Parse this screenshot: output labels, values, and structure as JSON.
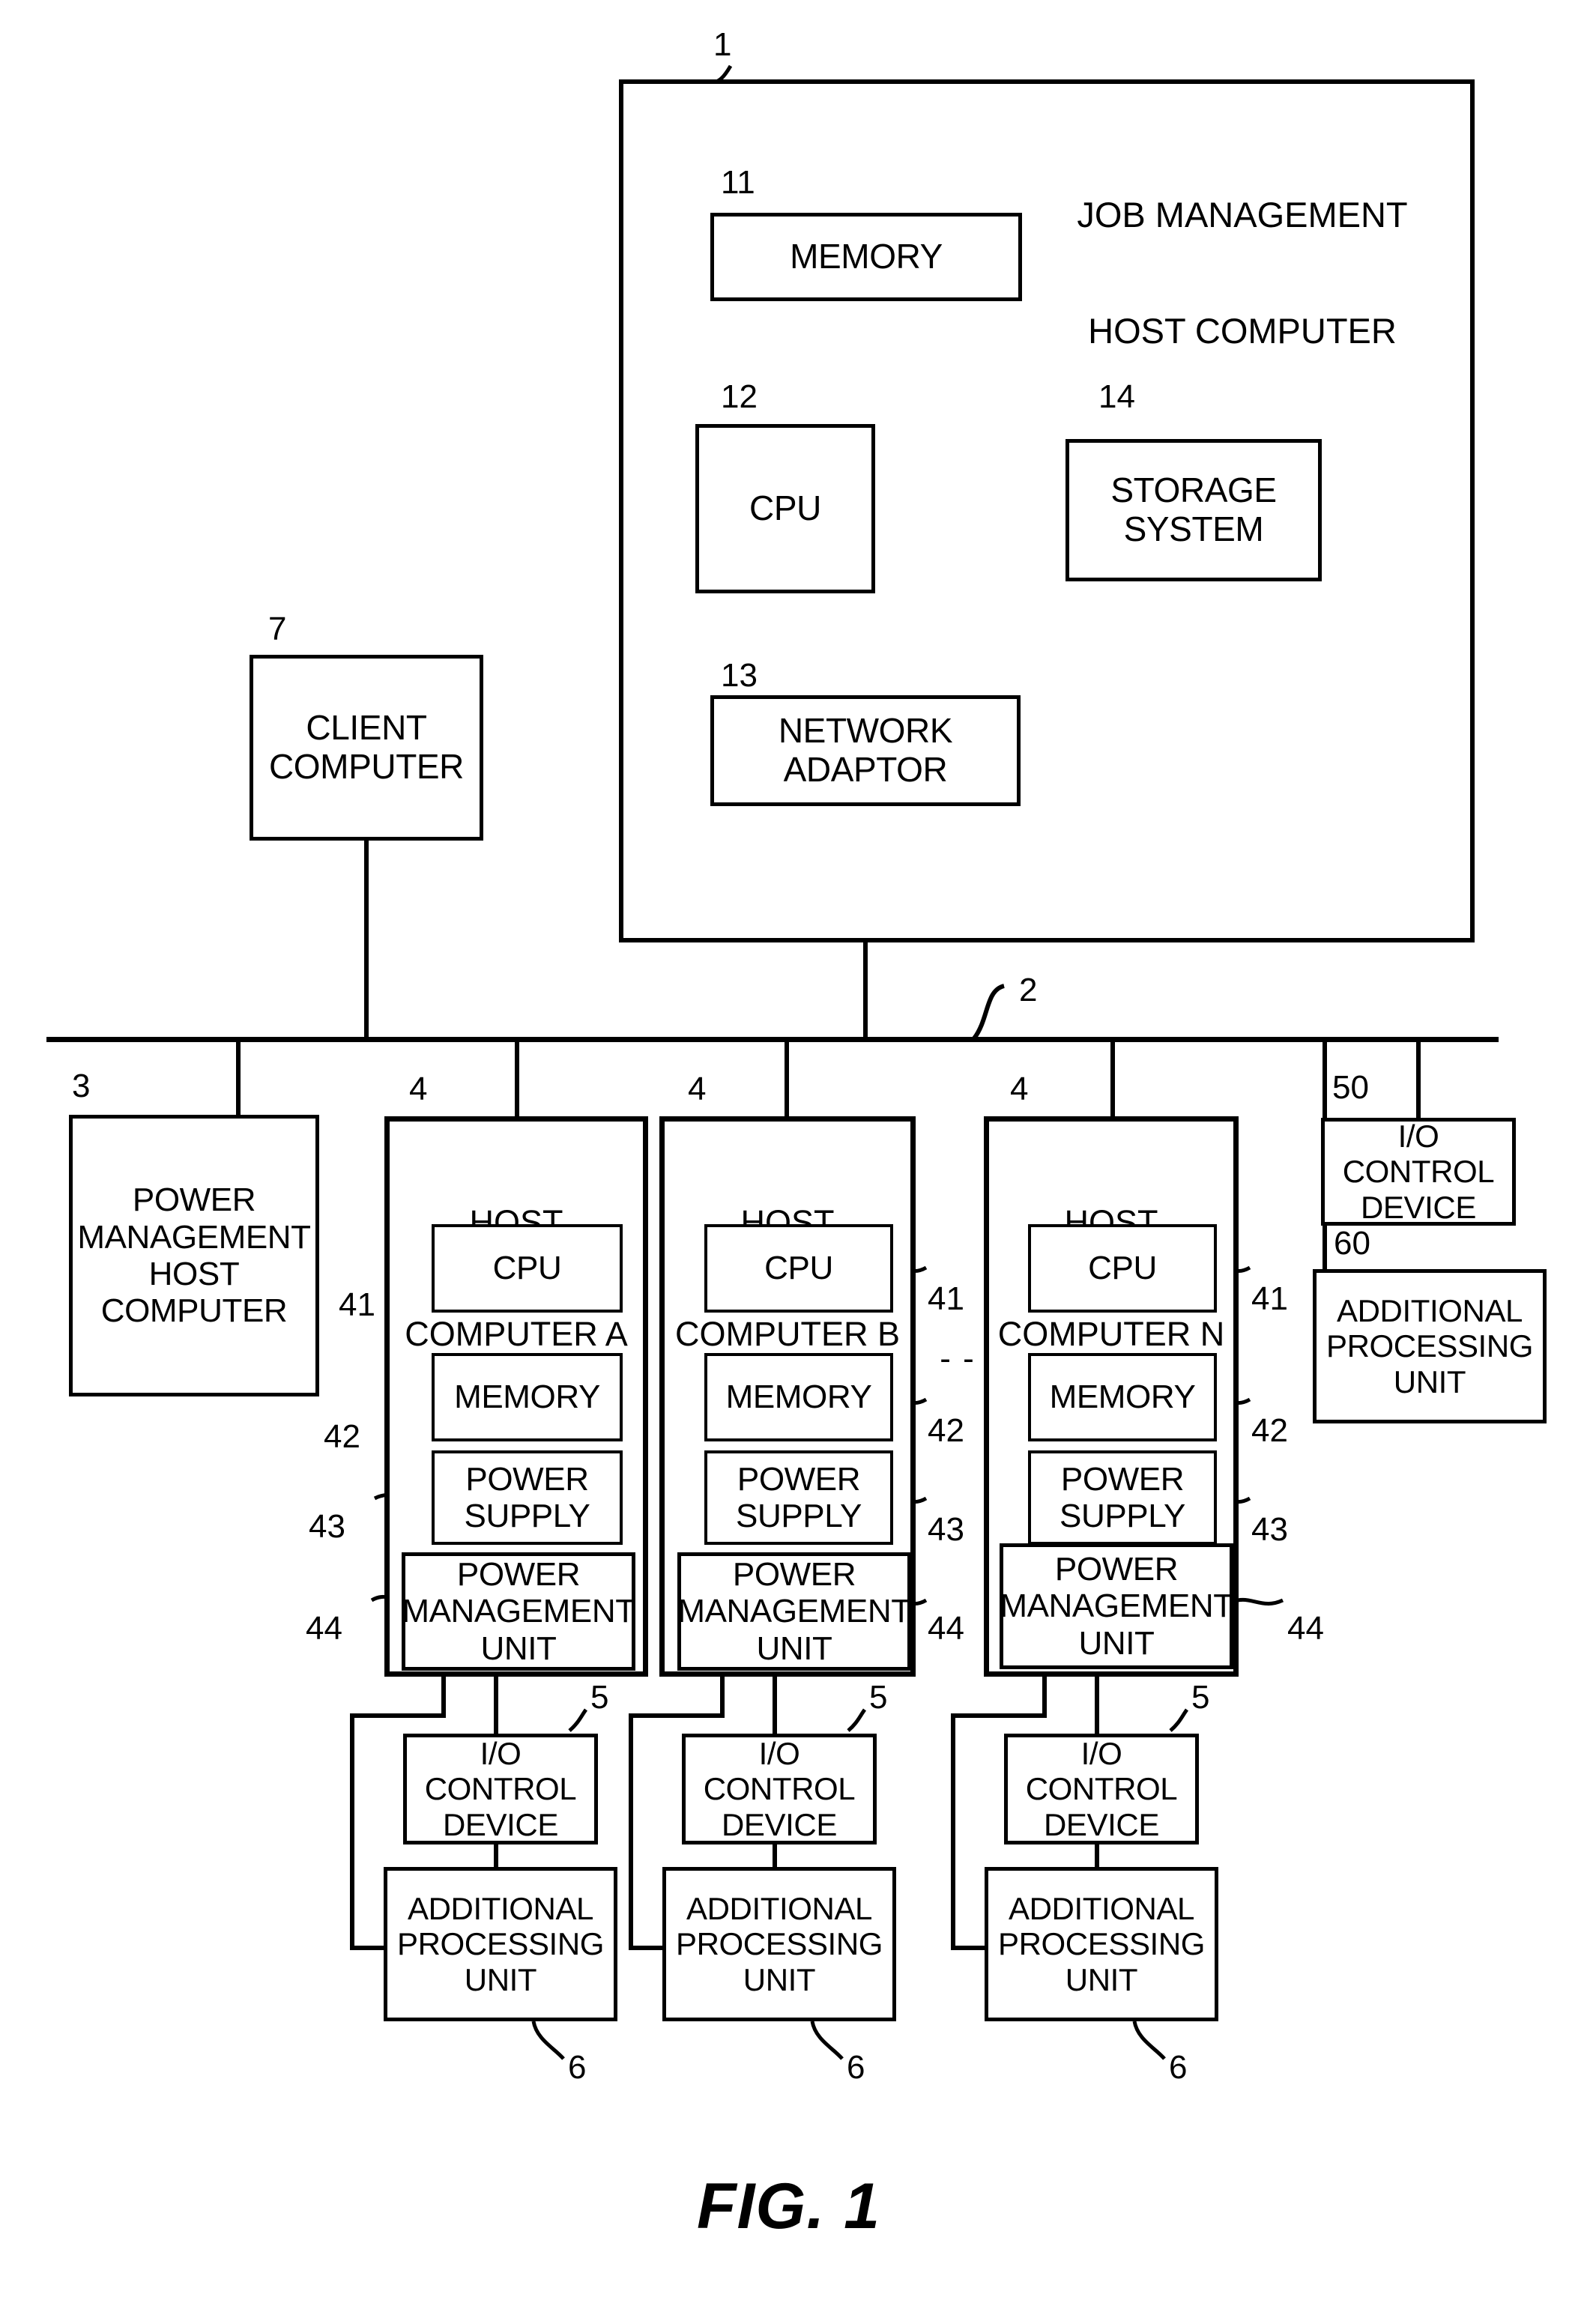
{
  "figure": {
    "caption": "FIG. 1",
    "title_label": "JOB MANAGEMENT\nHOST COMPUTER"
  },
  "host_system": {
    "ref": "1",
    "title_line1": "JOB MANAGEMENT",
    "title_line2": "HOST COMPUTER",
    "components": [
      {
        "ref": "11",
        "label": "MEMORY"
      },
      {
        "ref": "12",
        "label": "CPU"
      },
      {
        "ref": "13",
        "label": "NETWORK\nADAPTOR"
      },
      {
        "ref": "14",
        "label": "STORAGE\nSYSTEM"
      }
    ]
  },
  "client": {
    "ref": "7",
    "label": "CLIENT\nCOMPUTER"
  },
  "network": {
    "ref": "2"
  },
  "power_management_host": {
    "ref": "3",
    "label": "POWER\nMANAGEMENT\nHOST\nCOMPUTER"
  },
  "host_computers": [
    {
      "ref": "4",
      "title": "HOST\nCOMPUTER A",
      "parts": [
        {
          "ref": "41",
          "label": "CPU"
        },
        {
          "ref": "42",
          "label": "MEMORY"
        },
        {
          "ref": "43",
          "label": "POWER\nSUPPLY"
        },
        {
          "ref": "44",
          "label": "POWER\nMANAGEMENT\nUNIT"
        }
      ],
      "io_control_device": {
        "ref": "5",
        "label": "I/O\nCONTROL\nDEVICE"
      },
      "additional_processing_unit": {
        "ref": "6",
        "label": "ADDITIONAL\nPROCESSING\nUNIT"
      }
    },
    {
      "ref": "4",
      "title": "HOST\nCOMPUTER B",
      "parts": [
        {
          "ref": "41",
          "label": "CPU"
        },
        {
          "ref": "42",
          "label": "MEMORY"
        },
        {
          "ref": "43",
          "label": "POWER\nSUPPLY"
        },
        {
          "ref": "44",
          "label": "POWER\nMANAGEMENT\nUNIT"
        }
      ],
      "io_control_device": {
        "ref": "5",
        "label": "I/O\nCONTROL\nDEVICE"
      },
      "additional_processing_unit": {
        "ref": "6",
        "label": "ADDITIONAL\nPROCESSING\nUNIT"
      }
    },
    {
      "ref": "4",
      "title": "HOST\nCOMPUTER N",
      "parts": [
        {
          "ref": "41",
          "label": "CPU"
        },
        {
          "ref": "42",
          "label": "MEMORY"
        },
        {
          "ref": "43",
          "label": "POWER\nSUPPLY"
        },
        {
          "ref": "44",
          "label": "POWER\nMANAGEMENT\nUNIT"
        }
      ],
      "io_control_device": {
        "ref": "5",
        "label": "I/O\nCONTROL\nDEVICE"
      },
      "additional_processing_unit": {
        "ref": "6",
        "label": "ADDITIONAL\nPROCESSING\nUNIT"
      }
    }
  ],
  "shared_io_control_device": {
    "ref": "50",
    "label": "I/O\nCONTROL\nDEVICE"
  },
  "shared_additional_processing_unit": {
    "ref": "60",
    "label": "ADDITIONAL\nPROCESSING\nUNIT"
  },
  "ellipsis": "- -",
  "colors": {
    "ink": "#000000",
    "paper": "#ffffff"
  }
}
